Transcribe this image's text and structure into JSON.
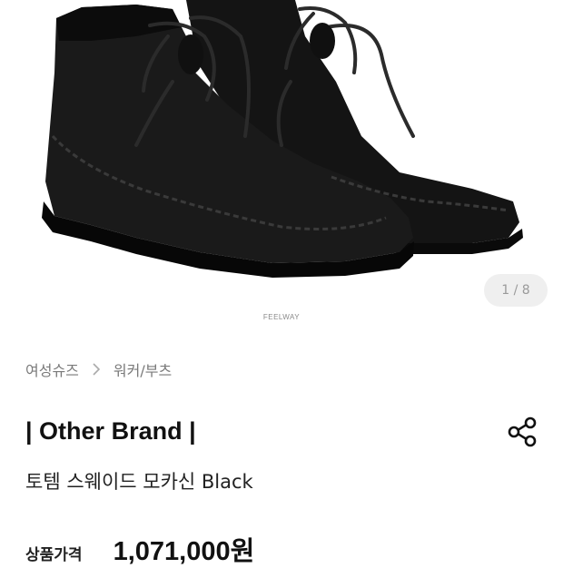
{
  "gallery": {
    "counter": "1 / 8",
    "watermark": "FEELWAY",
    "image_alt": "black suede moccasin boots"
  },
  "breadcrumb": {
    "items": [
      "여성슈즈",
      "워커/부츠"
    ]
  },
  "product": {
    "brand": "| Other Brand |",
    "name": "토템 스웨이드 모카신 Black",
    "price_label": "상품가격",
    "price": "1,071,000원"
  },
  "icons": {
    "share": "share-icon",
    "breadcrumb_separator": "chevron-right-icon"
  },
  "colors": {
    "text_primary": "#111111",
    "text_secondary": "#7a7a7a",
    "counter_bg": "#efefef"
  }
}
